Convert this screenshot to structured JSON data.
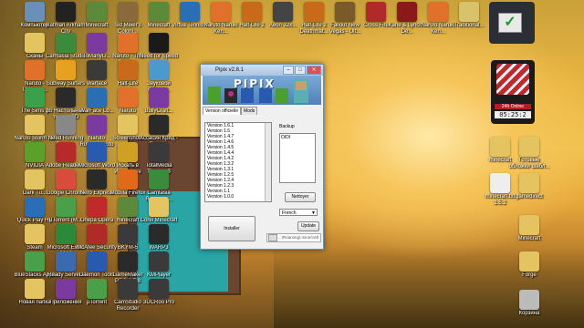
{
  "desktop_icons": [
    {
      "label": "Компьютер",
      "color": "#6a8fb8"
    },
    {
      "label": "Batman Arkham City",
      "color": "#222222"
    },
    {
      "label": "Minecraft",
      "color": "#5c8a3a"
    },
    {
      "label": "Sid Meier's Coloni...",
      "color": "#8a6a3a"
    },
    {
      "label": "Minecraft",
      "color": "#5c8a3a"
    },
    {
      "label": "Virtua Tennis 4",
      "color": "#2a6fb5"
    },
    {
      "label": "Naruto Naruki Ken...",
      "color": "#e0702a"
    },
    {
      "label": "Half-Life 2",
      "color": "#c96a1a"
    },
    {
      "label": "Aeon 32x...",
      "color": "#444444"
    },
    {
      "label": "Half-Life 2 Deathmat...",
      "color": "#c96a1a"
    },
    {
      "label": "Fallout New Vegas - Ult...",
      "color": "#7a5a2a"
    },
    {
      "label": "Cross Fire",
      "color": "#b02a2a"
    },
    {
      "label": "Kane & Lynch - De...",
      "color": "#8a1a1a"
    },
    {
      "label": "Naruto Naruki Ken...",
      "color": "#e0702a"
    },
    {
      "label": "Traditional...",
      "color": "#d8c36a"
    },
    {
      "label": "Сканы",
      "color": "#e4c460"
    },
    {
      "label": "Camtasia Studio 8.0.1",
      "color": "#3c8a3c"
    },
    {
      "label": "ТоМаnyLi...",
      "color": "#7a3aa0"
    },
    {
      "label": "Naruto - The Broke...",
      "color": "#e0702a"
    },
    {
      "label": "Need for Speed Hot...",
      "color": "#1a1a1a"
    },
    {
      "label": "Naruto - Ultimate...",
      "color": "#e0702a"
    },
    {
      "label": "Subway Surfers",
      "color": "#e9a020"
    },
    {
      "label": "Warface",
      "color": "#3a3a3a"
    },
    {
      "label": "Half-Life",
      "color": "#c96a1a"
    },
    {
      "label": "Звуковой фильм...",
      "color": "#4a9ad0"
    },
    {
      "label": "The Sims 3",
      "color": "#3aa04a"
    },
    {
      "label": "pb Настольный теннис 3D",
      "color": "#2a2a2a"
    },
    {
      "label": "WarFace Lo...",
      "color": "#2a6fb5"
    },
    {
      "label": "Naruto",
      "color": "#e0702a"
    },
    {
      "label": "BullyCraft...",
      "color": "#7a3aa0"
    },
    {
      "label": "Naruto Storm 3D Game",
      "color": "#e4c460"
    },
    {
      "label": "Need Running Roms...",
      "color": "#888888"
    },
    {
      "label": "Naruto RubbleNaruto ROM",
      "color": "#7a3aa0"
    },
    {
      "label": "Screenshots",
      "color": "#e4c460"
    },
    {
      "label": "Ассасин Крид - Revel...",
      "color": "#2a2a2a"
    },
    {
      "label": "NVIDIA",
      "color": "#5aa02a"
    },
    {
      "label": "Adobe Reader X",
      "color": "#b82a2a"
    },
    {
      "label": "Microsoft Word 2010",
      "color": "#2a5ab0"
    },
    {
      "label": "Искать в Интернете",
      "color": "#d0a020"
    },
    {
      "label": "TotalMedia Theatre 3",
      "color": "#3a3a3a"
    },
    {
      "label": "Dark Tu...",
      "color": "#e4c460"
    },
    {
      "label": "Google Chrome",
      "color": "#d94b3a"
    },
    {
      "label": "Nero Express",
      "color": "#2a2a2a"
    },
    {
      "label": "Mozilla Firefox",
      "color": "#e06a1a"
    },
    {
      "label": "Camtasia Recorder...",
      "color": "#3c8a3c"
    },
    {
      "label": "Quick Play HP (ll.M...",
      "color": "#2a6fb5"
    },
    {
      "label": "µTorrent (M...",
      "color": "#4aa04a"
    },
    {
      "label": "Опера Opera",
      "color": "#c02a2a"
    },
    {
      "label": "minecraft",
      "color": "#5c8a3a"
    },
    {
      "label": "Corel Minecraft",
      "color": "#e4c460"
    },
    {
      "label": "Steam",
      "color": "#e4c460"
    },
    {
      "label": "Microsoft Excel 2010",
      "color": "#2a8a3a"
    },
    {
      "label": "McAfee Security Sca...",
      "color": "#b02a2a"
    },
    {
      "label": "BKYM-5",
      "color": "#3a3a3a"
    },
    {
      "label": "WARP3",
      "color": "#2a2a2a"
    },
    {
      "label": "BlueStacks Apps",
      "color": "#4aa04a"
    },
    {
      "label": "Ready Servers",
      "color": "#3a6ab0"
    },
    {
      "label": "Daemon Tools Lite",
      "color": "#2a5ab0"
    },
    {
      "label": "GameMaker PRO 3.7.8",
      "color": "#2a2a2a"
    },
    {
      "label": "KMPlayer",
      "color": "#3a3a3a"
    },
    {
      "label": "Новая папка",
      "color": "#e4c460"
    },
    {
      "label": "Приложения",
      "color": "#7a3aa0"
    },
    {
      "label": "µTorrent",
      "color": "#4aa04a"
    },
    {
      "label": "CamStudio Recorder",
      "color": "#3a3a3a"
    },
    {
      "label": "3DCRoo Pro",
      "color": "#3a3a3a"
    }
  ],
  "right_icons": [
    {
      "label": "minecraft",
      "color": "#e4c460"
    },
    {
      "label": "Готовые обложки шабл...",
      "color": "#e4c460"
    },
    {
      "label": "minecraft.txt 1.5.2",
      "color": "#eeeeee"
    },
    {
      "label": "gamedirect",
      "color": "#e4c460"
    },
    {
      "label": "Minecraft",
      "color": "#e4c460"
    },
    {
      "label": "Forge",
      "color": "#e4c460"
    },
    {
      "label": "Корзина",
      "color": "#bbbbbb"
    }
  ],
  "window": {
    "title": "Pipix v2.8.1",
    "banner_text": "PIPIX",
    "tab_versions": "Version officielle",
    "tab_mods": "Mods",
    "versions": [
      "Version 1.6.1",
      "Version 1.5",
      "Version 1.4.7",
      "Version 1.4.6",
      "Version 1.4.5",
      "Version 1.4.4",
      "Version 1.4.2",
      "Version 1.3.2",
      "Version 1.3.1",
      "Version 1.2.5",
      "Version 1.2.4",
      "Version 1.2.3",
      "Version 1.1",
      "Version 1.0.0"
    ],
    "backup_label": "Backup",
    "backup_items": [
      "OIDI"
    ],
    "nettoyer_label": "Nettoyer",
    "language_value": "French",
    "update_label": "Update",
    "install_label": "Installer",
    "path_value": "...\\Roaming\\.minecraft"
  },
  "widgets": {
    "online_label": "24h Online",
    "clock_value": "05:25:2"
  }
}
